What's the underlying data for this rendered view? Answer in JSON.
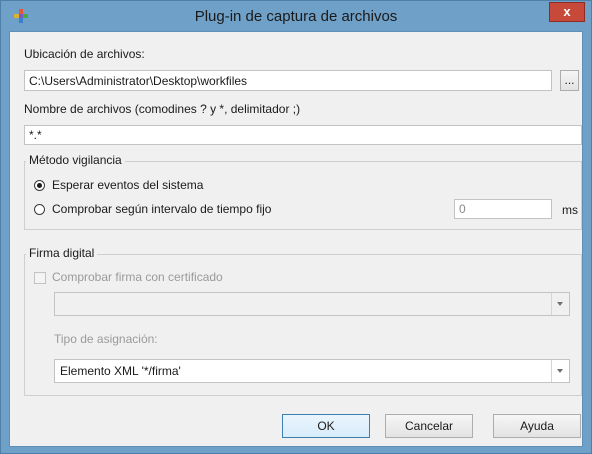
{
  "window": {
    "title": "Plug-in de captura de archivos",
    "close_glyph": "x",
    "app_icon": "plugin-cross-icon"
  },
  "location": {
    "label": "Ubicación de archivos:",
    "value": "C:\\Users\\Administrator\\Desktop\\workfiles",
    "browse_label": "..."
  },
  "filenames": {
    "label": "Nombre de archivos (comodines ? y *, delimitador ;)",
    "value": "*.*"
  },
  "monitoring": {
    "legend": "Método vigilancia",
    "option_events": "Esperar eventos del sistema",
    "option_interval": "Comprobar según intervalo de tiempo fijo",
    "selected": "events",
    "interval_value": "0",
    "interval_unit": "ms"
  },
  "signature": {
    "legend": "Firma digital",
    "check_label": "Comprobar firma con certificado",
    "certificate_value": "",
    "assignment_label": "Tipo de asignación:",
    "assignment_value": "Elemento XML '*/firma'"
  },
  "buttons": {
    "ok": "OK",
    "cancel": "Cancelar",
    "help": "Ayuda"
  },
  "colors": {
    "titlebar": "#6fa0c8",
    "close": "#c7493a",
    "dialog_bg": "#f0f0f0"
  }
}
